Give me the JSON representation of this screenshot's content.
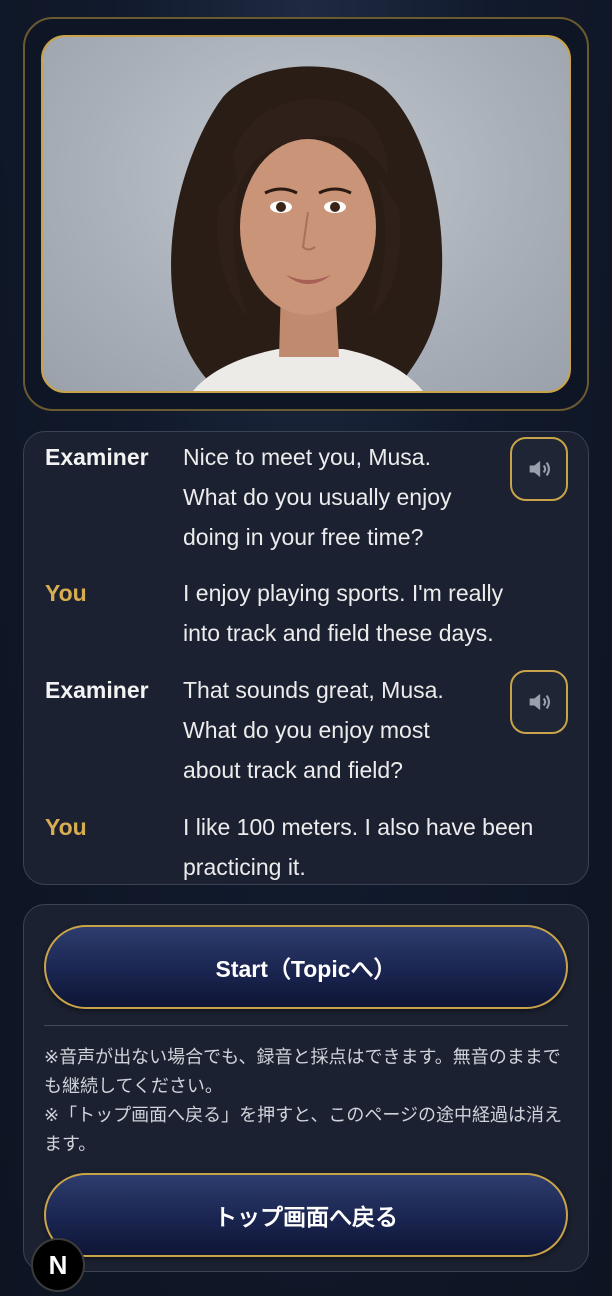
{
  "avatar": {
    "alt": "Examiner avatar"
  },
  "chat": {
    "messages": [
      {
        "speaker": "Examiner",
        "text": "Nice to meet you, Musa.\nWhat do you usually enjoy\ndoing in your free time?",
        "has_speak_button": true,
        "speak_icon": "speaker-icon"
      },
      {
        "speaker": "You",
        "text": "I enjoy playing sports. I'm really\ninto track and field these days.",
        "has_speak_button": false
      },
      {
        "speaker": "Examiner",
        "text": "That sounds great, Musa.\nWhat do you enjoy most\nabout track and field?",
        "has_speak_button": true,
        "speak_icon": "speaker-icon"
      },
      {
        "speaker": "You",
        "text": "I like 100 meters. I also have been\npracticing it.",
        "has_speak_button": false
      }
    ]
  },
  "controls": {
    "start_label": "Start（Topicへ）",
    "notes": [
      "※音声が出ない場合でも、録音と採点はできます。無音のままでも継続してください。",
      "※「トップ画面へ戻る」を押すと、このページの途中経過は消えます。"
    ],
    "back_label": "トップ画面へ戻る"
  },
  "badge": {
    "label": "N"
  },
  "colors": {
    "accent_gold": "#c9a34a",
    "you_label": "#d7ad52",
    "panel_bg": "#1b2130",
    "button_navy": "#1a2550"
  }
}
